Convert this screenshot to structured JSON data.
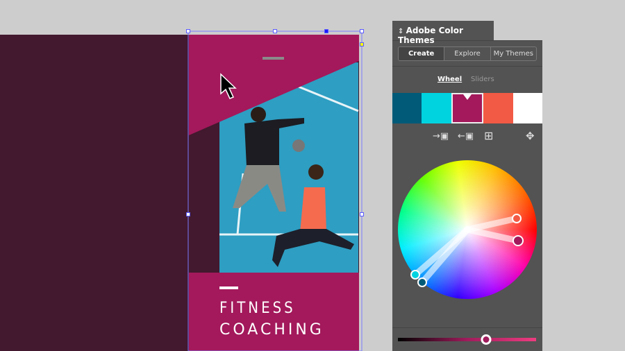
{
  "poster": {
    "title_line1": "FITNESS",
    "title_line2": "COACHING",
    "magenta": "#a3195b",
    "dark": "#42192e"
  },
  "panel": {
    "title": "Adobe Color Themes",
    "tabs": [
      {
        "label": "Create",
        "active": true
      },
      {
        "label": "Explore",
        "active": false
      },
      {
        "label": "My Themes",
        "active": false
      }
    ],
    "modes": [
      {
        "label": "Wheel",
        "active": true
      },
      {
        "label": "Sliders",
        "active": false
      }
    ],
    "swatches": [
      "#005a78",
      "#00d3e0",
      "#a3195b",
      "#f25a45",
      "#ffffff"
    ],
    "selected_swatch": 2,
    "tools": [
      "add-to-swatches-icon",
      "load-from-swatches-icon",
      "add-grid-icon",
      "color-rule-icon"
    ],
    "brightness": 0.64
  }
}
